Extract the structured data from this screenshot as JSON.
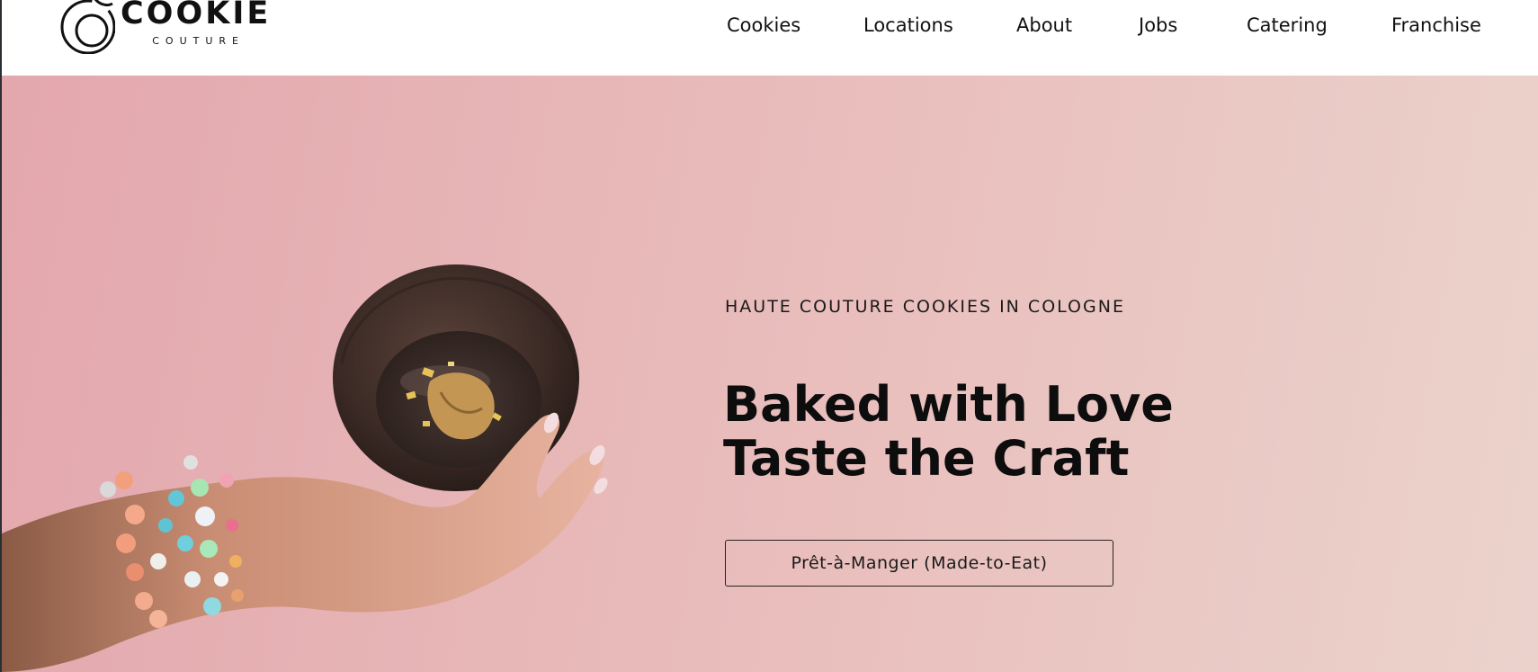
{
  "brand": {
    "name": "COOKIE",
    "tagline": "COUTURE"
  },
  "nav": {
    "items": [
      {
        "label": "Cookies"
      },
      {
        "label": "Locations"
      },
      {
        "label": "About"
      },
      {
        "label": "Jobs"
      },
      {
        "label": "Catering"
      },
      {
        "label": "Franchise"
      }
    ]
  },
  "hero": {
    "eyebrow": "HAUTE COUTURE COOKIES IN COLOGNE",
    "headline_line1": "Baked with Love",
    "headline_line2": "Taste the Craft",
    "cta_label": "Prêt-à-Manger (Made-to-Eat)",
    "image_icon": "cookie-in-hand-photo"
  },
  "colors": {
    "hero_bg_start": "#e3a7ad",
    "hero_bg_end": "#ebd3cc",
    "text": "#111111"
  }
}
